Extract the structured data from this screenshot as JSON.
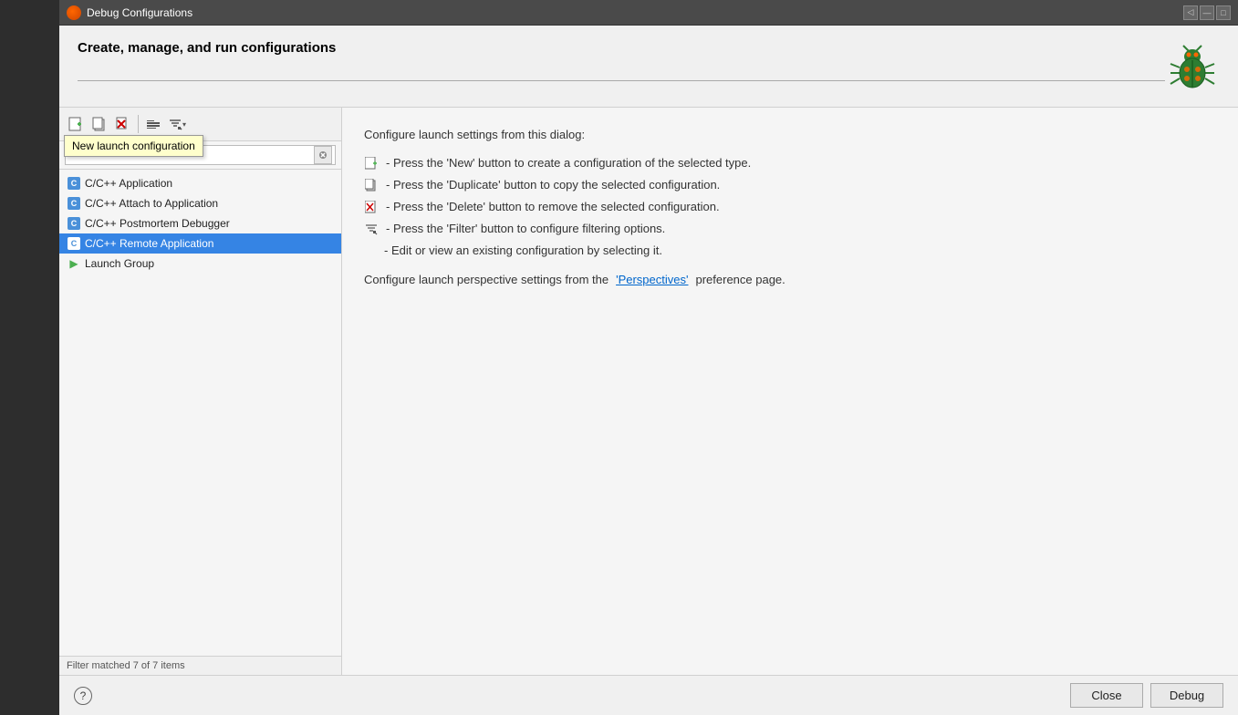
{
  "window": {
    "title": "Debug Configurations",
    "title_bar_icon": "●"
  },
  "header": {
    "title": "Create, manage, and run configurations",
    "input_value": "",
    "input_cursor": true
  },
  "toolbar": {
    "new_btn": "□+",
    "duplicate_btn": "⧉",
    "delete_btn": "✕",
    "collapse_btn": "⊟",
    "filter_btn": "⊞▾"
  },
  "search": {
    "placeholder": ""
  },
  "tree": {
    "items": [
      {
        "id": 1,
        "label": "C/C++ Application",
        "icon": "c",
        "selected": false
      },
      {
        "id": 2,
        "label": "C/C++ Attach to Application",
        "icon": "c",
        "selected": false
      },
      {
        "id": 3,
        "label": "C/C++ Postmortem Debugger",
        "icon": "c",
        "selected": false
      },
      {
        "id": 4,
        "label": "C/C++ Remote Application",
        "icon": "c",
        "selected": true
      },
      {
        "id": 5,
        "label": "Launch Group",
        "icon": "arrow",
        "selected": false
      }
    ]
  },
  "filter_status": "Filter matched 7 of 7 items",
  "right_panel": {
    "intro": "Configure launch settings from this dialog:",
    "items": [
      {
        "icon": "new",
        "text": "- Press the 'New' button to create a configuration of the selected type."
      },
      {
        "icon": "duplicate",
        "text": "- Press the 'Duplicate' button to copy the selected configuration."
      },
      {
        "icon": "delete",
        "text": "- Press the 'Delete' button to remove the selected configuration."
      },
      {
        "icon": "filter",
        "text": "- Press the 'Filter' button to configure filtering options."
      },
      {
        "icon": "none",
        "text": "- Edit or view an existing configuration by selecting it."
      }
    ],
    "perspectives_pre": "Configure launch perspective settings from the ",
    "perspectives_link": "'Perspectives'",
    "perspectives_post": " preference page."
  },
  "footer": {
    "help_label": "?",
    "close_label": "Close",
    "debug_label": "Debug"
  },
  "tooltip": {
    "text": "New launch configuration",
    "visible": true
  }
}
